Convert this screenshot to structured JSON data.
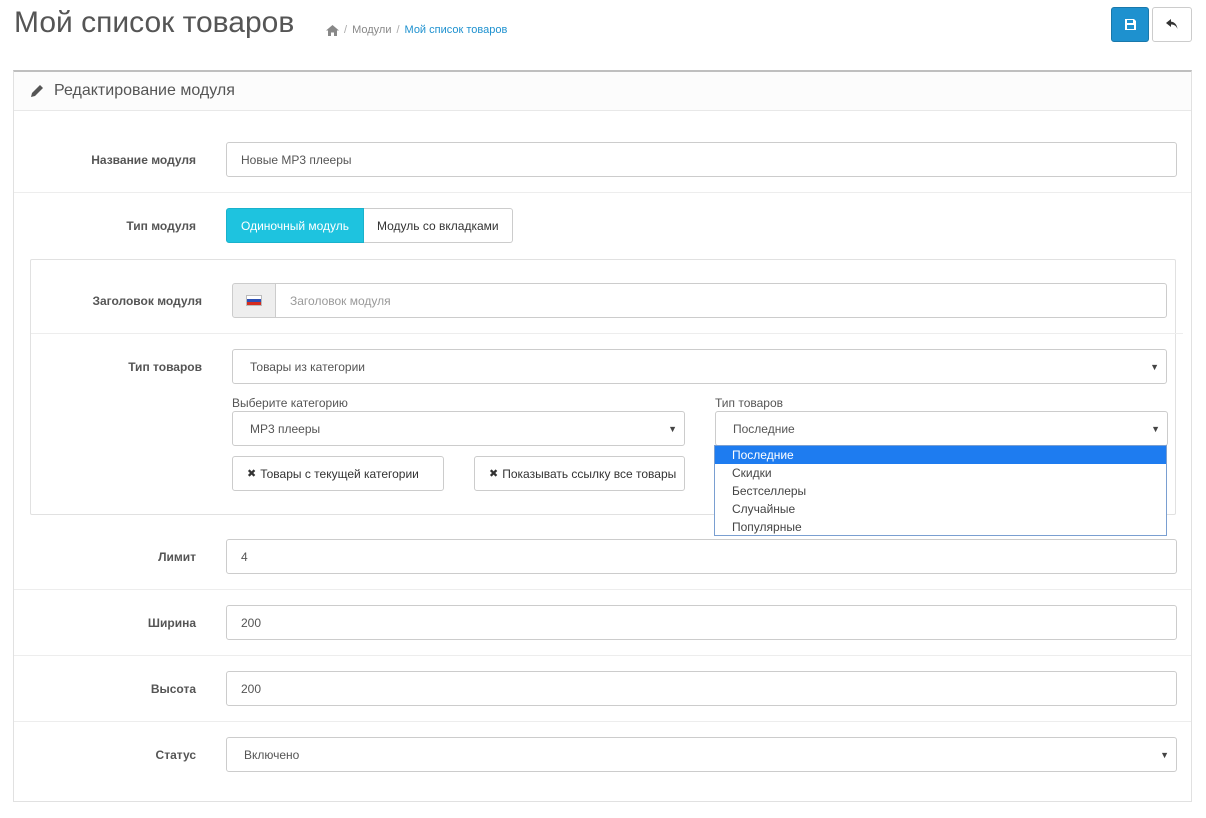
{
  "header": {
    "title": "Мой список товаров",
    "breadcrumb": {
      "modules": "Модули",
      "current": "Мой список товаров",
      "sep": "/"
    }
  },
  "panel": {
    "heading": "Редактирование модуля"
  },
  "form": {
    "name": {
      "label": "Название модуля",
      "value": "Новые MP3 плееры"
    },
    "module_type": {
      "label": "Тип модуля",
      "active": "Одиночный модуль",
      "inactive": "Модуль со вкладками"
    },
    "module_heading": {
      "label": "Заголовок модуля",
      "placeholder": "Заголовок модуля"
    },
    "product_source": {
      "label": "Тип товаров",
      "value": "Товары из категории"
    },
    "category": {
      "label": "Выберите категорию",
      "value": "MP3 плееры"
    },
    "product_kind": {
      "label": "Тип товаров",
      "value": "Последние",
      "options": [
        "Последние",
        "Скидки",
        "Бестселлеры",
        "Случайные",
        "Популярные"
      ]
    },
    "btn_current_category": "Товары с текущей категории",
    "btn_show_all_link": "Показывать ссылку все товары",
    "limit": {
      "label": "Лимит",
      "value": "4"
    },
    "width": {
      "label": "Ширина",
      "value": "200"
    },
    "height": {
      "label": "Высота",
      "value": "200"
    },
    "status": {
      "label": "Статус",
      "value": "Включено"
    }
  },
  "colors": {
    "primary": "#1e91cf",
    "active_toggle": "#1ec3df",
    "selected_option": "#1e7cf0"
  }
}
